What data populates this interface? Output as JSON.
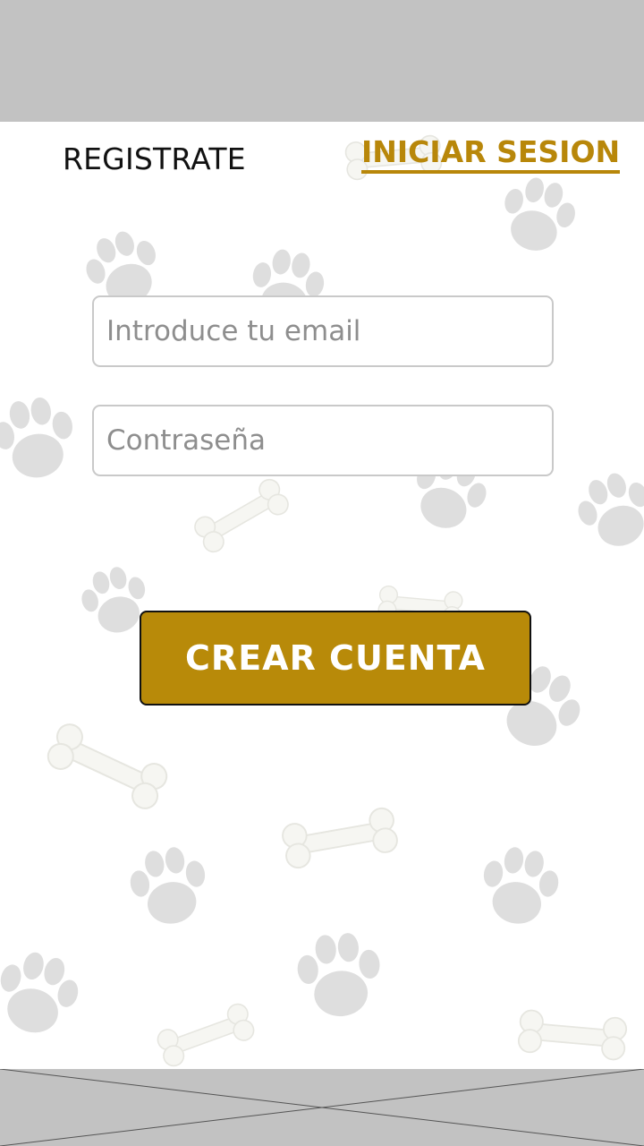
{
  "header": {
    "register_tab": "REGISTRATE",
    "login_tab": "INICIAR SESION"
  },
  "form": {
    "email_placeholder": "Introduce tu email",
    "password_placeholder": "Contraseña",
    "submit_label": "CREAR CUENTA"
  },
  "colors": {
    "accent": "#b8870a",
    "bar_gray": "#c2c2c2",
    "paw_gray": "#dcdcdc"
  }
}
